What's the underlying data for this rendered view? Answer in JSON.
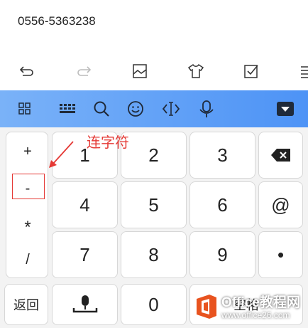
{
  "input": {
    "text": "0556-5363238"
  },
  "toolbar": {
    "icons": [
      "undo-icon",
      "redo-icon",
      "image-icon",
      "shirt-icon",
      "checkbox-icon",
      "menu-icon"
    ]
  },
  "keyboard_bar": {
    "icons": [
      "grid-icon",
      "keyboard-icon",
      "search-icon",
      "emoji-icon",
      "cursor-icon",
      "mic-icon",
      "collapse-icon"
    ],
    "accent": "#4d93f6"
  },
  "symbols": [
    "+",
    "-",
    "*",
    "/"
  ],
  "numpad": {
    "row1": [
      "1",
      "2",
      "3"
    ],
    "row2": [
      "4",
      "5",
      "6",
      "@"
    ],
    "row3": [
      "7",
      "8",
      "9",
      "•"
    ],
    "row4": {
      "back": "返回",
      "zero": "0",
      "space": "空格"
    }
  },
  "annotation": {
    "text": "连字符",
    "color": "#e53935"
  },
  "watermark": {
    "title": "Office教程网",
    "url": "www.office26.com"
  }
}
